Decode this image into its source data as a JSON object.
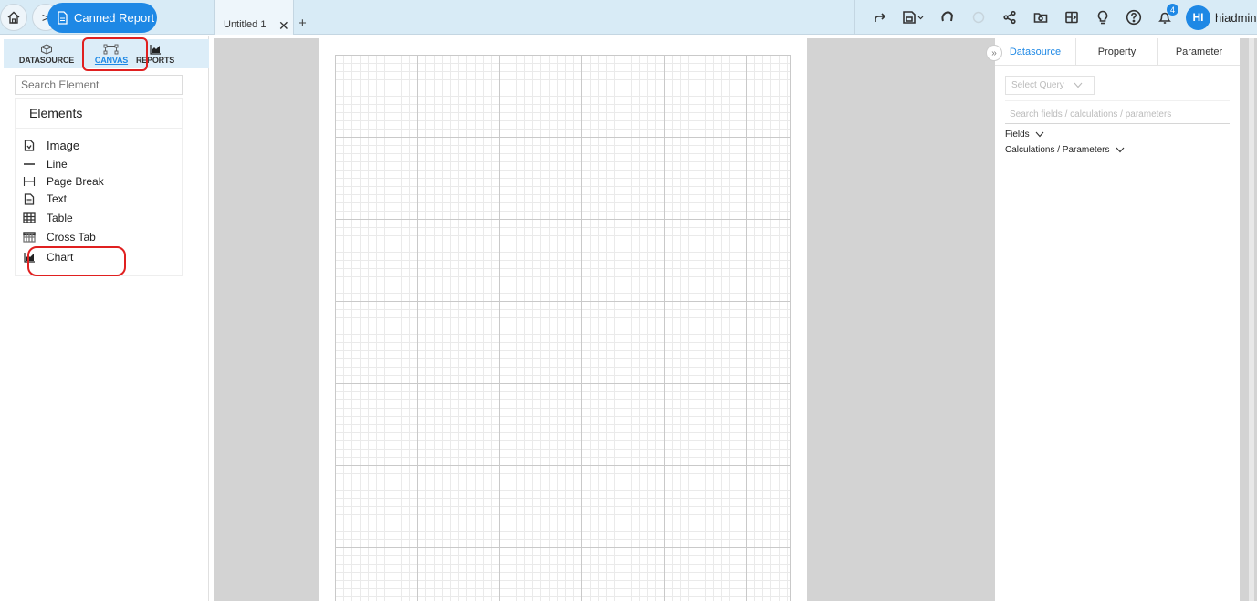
{
  "breadcrumb": {
    "current": "Canned Report"
  },
  "document_tabs": [
    {
      "label": "Untitled 1",
      "close_glyph": "✕"
    }
  ],
  "add_tab_glyph": "+",
  "toolbar": {
    "icons": [
      "redo-icon",
      "save-icon",
      "refresh-icon",
      "loading-icon",
      "share-icon",
      "folder-icon",
      "layout-icon",
      "lightbulb-icon",
      "help-icon",
      "notification-icon"
    ],
    "notification_count": "4",
    "avatar_initials": "HI",
    "username": "hiadmin"
  },
  "left_panel": {
    "tabs": [
      {
        "label": "DATASOURCE",
        "icon": "cube-icon"
      },
      {
        "label": "CANVAS",
        "icon": "canvas-icon",
        "active": true
      },
      {
        "label": "REPORTS",
        "icon": "chart-icon"
      }
    ],
    "search_placeholder": "Search Element",
    "elements_title": "Elements",
    "elements": [
      {
        "label": "Image",
        "icon": "image-icon"
      },
      {
        "label": "Line",
        "icon": "line-icon"
      },
      {
        "label": "Page Break",
        "icon": "page-break-icon"
      },
      {
        "label": "Text",
        "icon": "text-icon"
      },
      {
        "label": "Table",
        "icon": "table-icon"
      },
      {
        "label": "Cross Tab",
        "icon": "cross-tab-icon"
      },
      {
        "label": "Chart",
        "icon": "chart-icon"
      }
    ]
  },
  "right_panel": {
    "tabs": [
      {
        "label": "Datasource",
        "active": true
      },
      {
        "label": "Property"
      },
      {
        "label": "Parameter"
      }
    ],
    "select_query_placeholder": "Select Query",
    "field_search_placeholder": "Search fields / calculations / parameters",
    "sections": [
      {
        "label": "Fields"
      },
      {
        "label": "Calculations / Parameters"
      }
    ]
  },
  "colors": {
    "accent": "#1e88e5",
    "topbar": "#d8ebf6",
    "highlight": "#e02020",
    "canvas_bg": "#d3d3d3"
  }
}
